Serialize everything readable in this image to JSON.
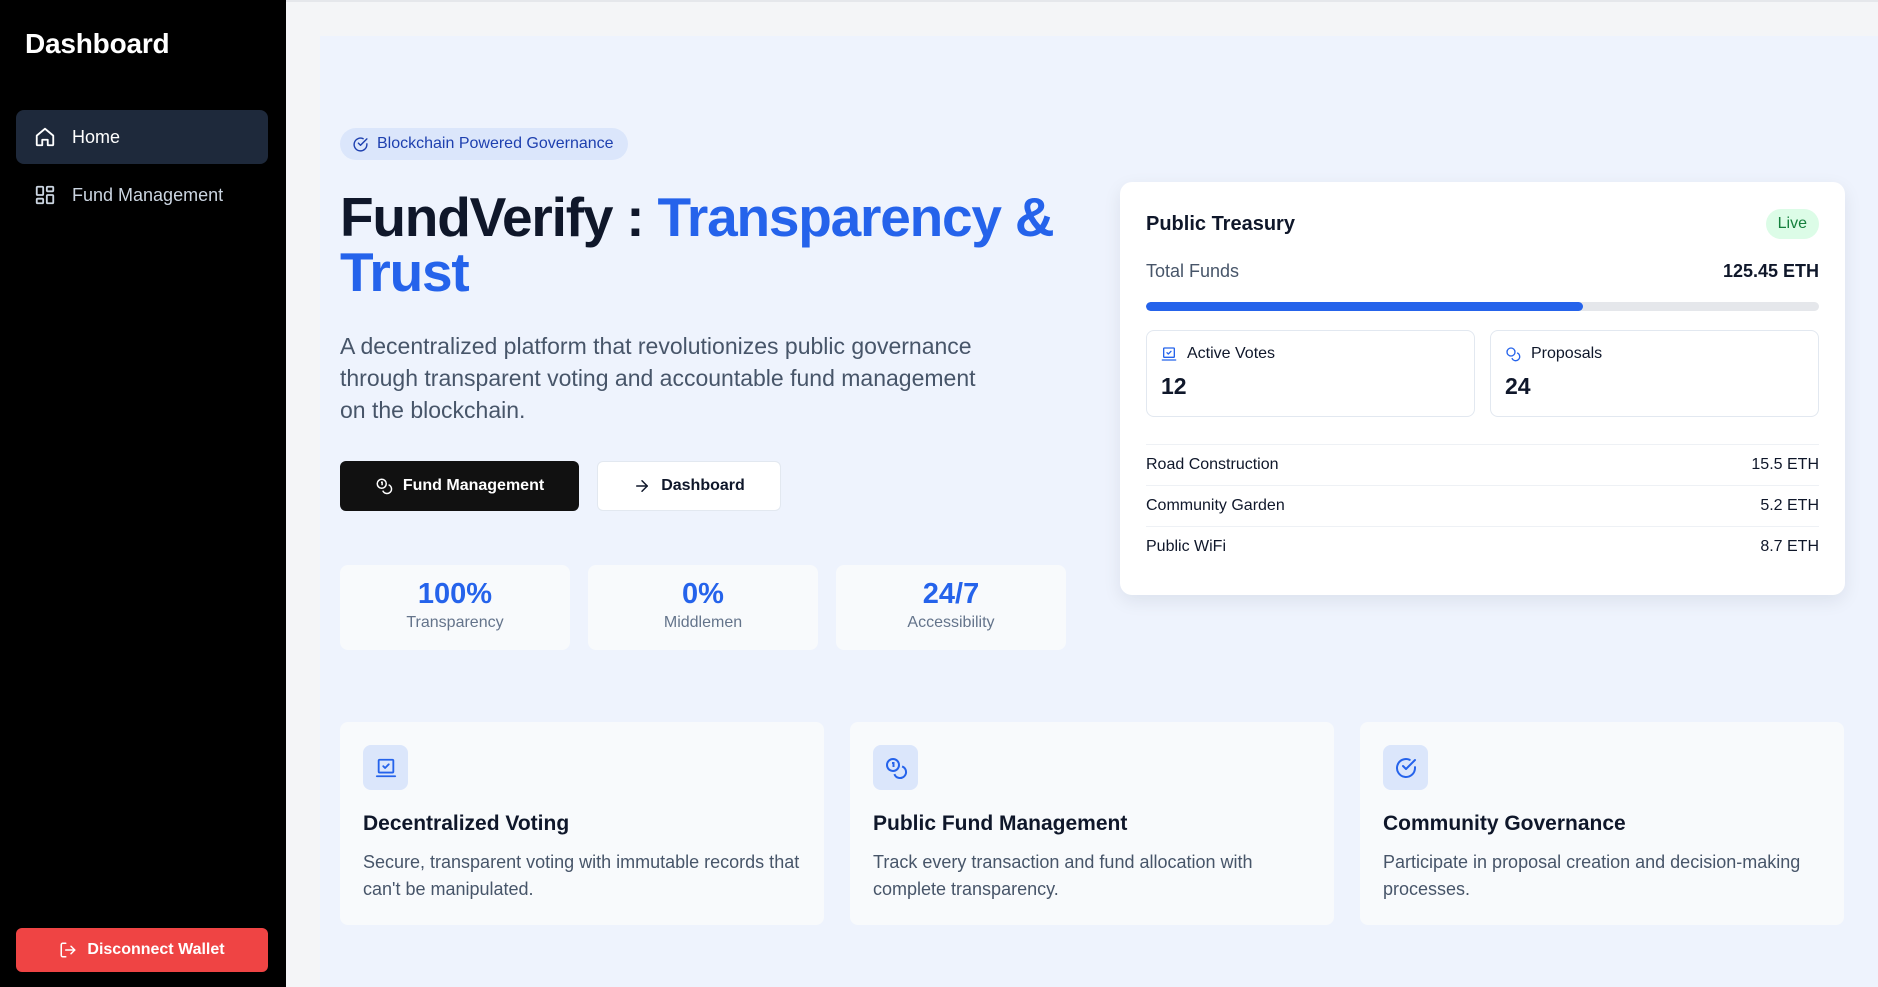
{
  "sidebar": {
    "brand": "Dashboard",
    "items": [
      {
        "label": "Home",
        "icon": "home-icon",
        "active": true
      },
      {
        "label": "Fund Management",
        "icon": "grid-icon",
        "active": false
      }
    ],
    "disconnect_label": "Disconnect Wallet"
  },
  "hero": {
    "badge": "Blockchain Powered Governance",
    "title_main": "FundVerify : ",
    "title_accent": "Transparency & Trust",
    "description": "A decentralized platform that revolutionizes public governance through transparent voting and accountable fund management on the blockchain.",
    "primary_button": "Fund Management",
    "secondary_button": "Dashboard"
  },
  "stats": [
    {
      "value": "100%",
      "label": "Transparency"
    },
    {
      "value": "0%",
      "label": "Middlemen"
    },
    {
      "value": "24/7",
      "label": "Accessibility"
    }
  ],
  "treasury": {
    "title": "Public Treasury",
    "status": "Live",
    "total_label": "Total Funds",
    "total_value": "125.45 ETH",
    "progress_fraction": 0.65,
    "active_votes_label": "Active Votes",
    "active_votes_value": "12",
    "proposals_label": "Proposals",
    "proposals_value": "24",
    "allocations": [
      {
        "name": "Road Construction",
        "amount": "15.5 ETH"
      },
      {
        "name": "Community Garden",
        "amount": "5.2 ETH"
      },
      {
        "name": "Public WiFi",
        "amount": "8.7 ETH"
      }
    ]
  },
  "features": [
    {
      "title": "Decentralized Voting",
      "description": "Secure, transparent voting with immutable records that can't be manipulated.",
      "icon": "vote-box-icon"
    },
    {
      "title": "Public Fund Management",
      "description": "Track every transaction and fund allocation with complete transparency.",
      "icon": "coins-icon"
    },
    {
      "title": "Community Governance",
      "description": "Participate in proposal creation and decision-making processes.",
      "icon": "check-circle-icon"
    }
  ],
  "colors": {
    "accent": "#2563eb",
    "sidebar_bg": "#000000",
    "danger": "#ef4444",
    "live_bg": "#dcfce7",
    "live_text": "#15803d"
  }
}
